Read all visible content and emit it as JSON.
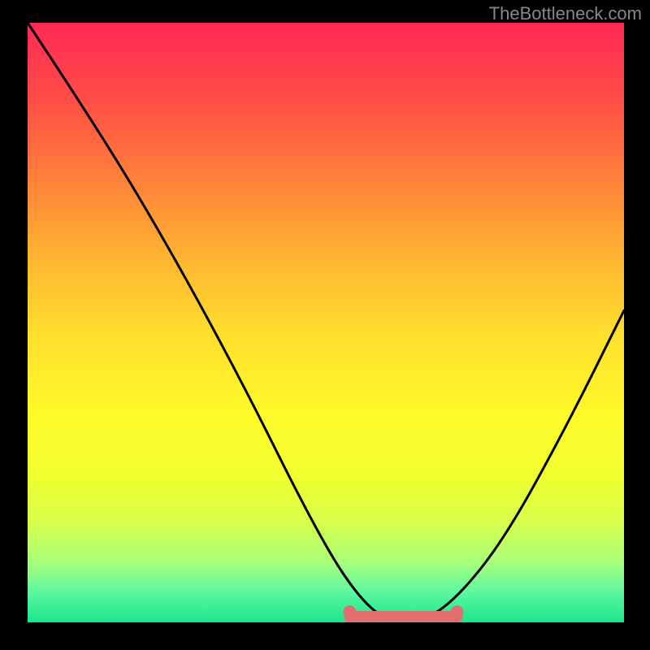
{
  "watermark": "TheBottleneck.com",
  "chart_data": {
    "type": "line",
    "title": "",
    "xlabel": "",
    "ylabel": "",
    "xlim": [
      0,
      100
    ],
    "ylim": [
      0,
      100
    ],
    "grid": false,
    "legend": null,
    "series": [
      {
        "name": "bottleneck-curve",
        "x": [
          0,
          12,
          24,
          36,
          47,
          54,
          60,
          66,
          72,
          80,
          90,
          100
        ],
        "y": [
          100,
          82,
          62,
          40,
          18,
          6,
          0,
          0,
          4,
          14,
          32,
          52
        ]
      }
    ],
    "annotations": [
      {
        "name": "optimal-range-marker",
        "x_start": 54,
        "x_end": 72,
        "y": 0
      }
    ],
    "colors": {
      "background_top": "#ff2a55",
      "background_bottom": "#1ae68a",
      "curve": "#000000",
      "marker": "#e07070"
    }
  }
}
